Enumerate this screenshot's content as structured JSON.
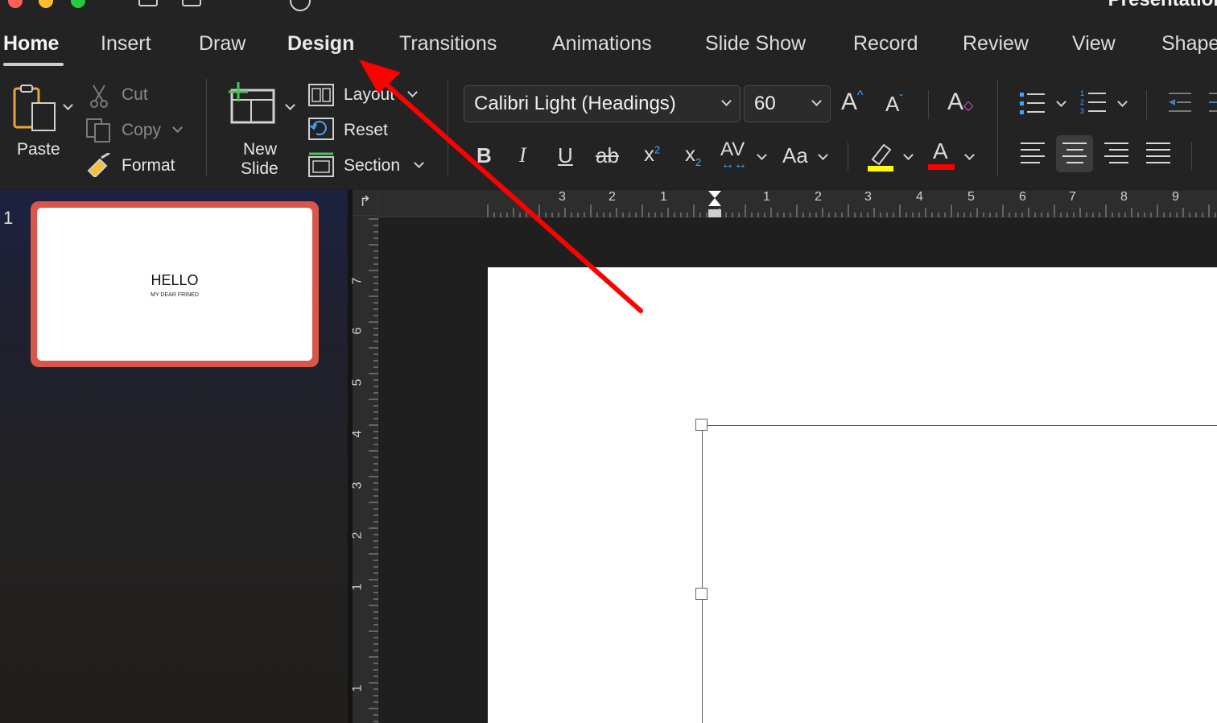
{
  "window": {
    "title": "Presentation"
  },
  "tabs": [
    {
      "label": "Home"
    },
    {
      "label": "Insert"
    },
    {
      "label": "Draw"
    },
    {
      "label": "Design"
    },
    {
      "label": "Transitions"
    },
    {
      "label": "Animations"
    },
    {
      "label": "Slide Show"
    },
    {
      "label": "Record"
    },
    {
      "label": "Review"
    },
    {
      "label": "View"
    },
    {
      "label": "Shape"
    }
  ],
  "clipboard": {
    "paste": "Paste",
    "cut": "Cut",
    "copy": "Copy",
    "format": "Format"
  },
  "slides_group": {
    "new_slide_line1": "New",
    "new_slide_line2": "Slide",
    "layout": "Layout",
    "reset": "Reset",
    "section": "Section"
  },
  "font": {
    "name": "Calibri Light (Headings)",
    "size": "60"
  },
  "format_buttons": {
    "bold": "B",
    "italic": "I",
    "underline": "U",
    "strike": "ab",
    "superscript": "x",
    "sup_mark": "2",
    "subscript": "x",
    "sub_mark": "2",
    "spacing": "AV",
    "change_case": "Aa",
    "font_color": "A"
  },
  "colors": {
    "highlight": "#ffff00",
    "font_color": "#ff0000",
    "accent_selection": "#d9564a",
    "annotation_arrow": "#ff0000"
  },
  "slide_panel": {
    "slide_number": "1",
    "thumb_title": "HELLO",
    "thumb_subtitle": "MY DEAR FRINED"
  },
  "ruler": {
    "horizontal": [
      "3",
      "2",
      "1",
      "1",
      "2",
      "3",
      "4",
      "5",
      "6",
      "7",
      "8",
      "9"
    ],
    "vertical": [
      "7",
      "6",
      "5",
      "4",
      "3",
      "2",
      "1",
      "1"
    ]
  }
}
